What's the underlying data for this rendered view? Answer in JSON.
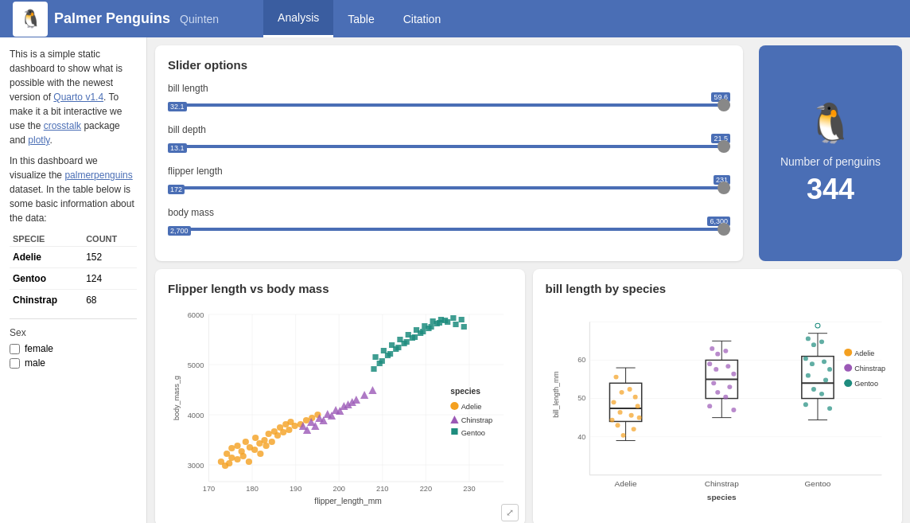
{
  "app": {
    "title": "Palmer Penguins",
    "subtitle": "Quinten",
    "logo_emoji": "🐧"
  },
  "nav": {
    "items": [
      {
        "label": "Analysis",
        "active": true
      },
      {
        "label": "Table",
        "active": false
      },
      {
        "label": "Citation",
        "active": false
      }
    ]
  },
  "sidebar": {
    "description1": "This is a simple static dashboard to show what is possible with the newest version of ",
    "link1": "Quarto v1.4",
    "description2": ". To make it a bit interactive we use the ",
    "link2": "crosstalk",
    "description3": " package and ",
    "link3": "plotly",
    "description4": ".",
    "description5": "In this dashboard we visualize the ",
    "link4": "palmerpenguins",
    "description6": " dataset. In the table below is some basic information about the data:",
    "table": {
      "headers": [
        "SPECIE",
        "COUNT"
      ],
      "rows": [
        {
          "species": "Adelie",
          "count": "152"
        },
        {
          "species": "Gentoo",
          "count": "124"
        },
        {
          "species": "Chinstrap",
          "count": "68"
        }
      ]
    },
    "sex_label": "Sex",
    "sex_options": [
      "female",
      "male"
    ]
  },
  "sliders": {
    "title": "Slider options",
    "items": [
      {
        "label": "bill length",
        "min": "32.1",
        "max": "59.6",
        "min_val": 32.1,
        "max_val": 59.6
      },
      {
        "label": "bill depth",
        "min": "13.1",
        "max": "21.5",
        "min_val": 13.1,
        "max_val": 21.5
      },
      {
        "label": "flipper length",
        "min": "172",
        "max": "231",
        "min_val": 172,
        "max_val": 231
      },
      {
        "label": "body mass",
        "min": "2,700",
        "max": "6,300",
        "min_val": 2700,
        "max_val": 6300
      }
    ]
  },
  "stat_card": {
    "label": "Number of penguins",
    "value": "344"
  },
  "scatter_chart": {
    "title": "Flipper length vs body mass",
    "x_label": "flipper_length_mm",
    "y_label": "body_mass_g",
    "x_ticks": [
      "170",
      "180",
      "190",
      "200",
      "210",
      "220",
      "230"
    ],
    "y_ticks": [
      "3000",
      "4000",
      "5000",
      "6000"
    ],
    "legend": {
      "title": "species",
      "items": [
        {
          "label": "Adelie",
          "color": "#f4a020",
          "shape": "circle"
        },
        {
          "label": "Chinstrap",
          "color": "#9b59b6",
          "shape": "triangle"
        },
        {
          "label": "Gentoo",
          "color": "#1e8c7e",
          "shape": "square"
        }
      ]
    }
  },
  "boxplot_chart": {
    "title": "bill length by species",
    "x_label": "species",
    "y_label": "bill_length_mm",
    "y_ticks": [
      "40",
      "50",
      "60"
    ],
    "x_ticks": [
      "Adelie",
      "Chinstrap",
      "Gentoo"
    ],
    "legend": {
      "items": [
        {
          "label": "Adelie",
          "color": "#f4a020"
        },
        {
          "label": "Chinstrap",
          "color": "#9b59b6"
        },
        {
          "label": "Gentoo",
          "color": "#1e8c7e"
        }
      ]
    }
  }
}
